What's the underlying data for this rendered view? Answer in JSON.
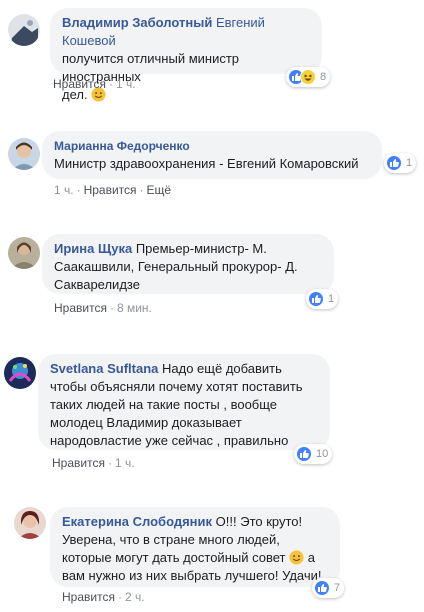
{
  "comments": [
    {
      "author": "Владимир Заболотный",
      "mention": "Евгений Кошевой",
      "text_line1": "получится отличный министр иностранных",
      "text_line2": "дел.",
      "emoji": "smile-emoji",
      "like_label": "Нравится",
      "time": "1 ч.",
      "reaction_count": "8",
      "reaction_icons": [
        "like-icon",
        "haha-icon"
      ],
      "avatar_color": "#3b4a5e"
    },
    {
      "author": "Марианна Федорченко",
      "text": "Министр здравоохранения - Евгений Комаровский",
      "time": "1 ч.",
      "like_label": "Нравится",
      "more_label": "Ещё",
      "reaction_count": "1",
      "reaction_icons": [
        "like-icon"
      ],
      "avatar_color": "#7a9ab5"
    },
    {
      "author": "Ирина Щука",
      "text_part1": "Премьер-министр- М.",
      "text_line2": "Саакашвили, Генеральный прокурор- Д.",
      "text_line3": "Сакварелидзе",
      "like_label": "Нравится",
      "time": "8 мин.",
      "reaction_count": "1",
      "reaction_icons": [
        "like-icon"
      ],
      "avatar_color": "#8a7f6a"
    },
    {
      "author": "Svetlana Sufltana",
      "text_part1": "Надо ещё добавить",
      "text_line2": "чтобы объясняли почему хотят поставить",
      "text_line3": "таких людей на такие посты , вообще",
      "text_line4": "молодец Владимир доказывает",
      "text_line5": "народовластие уже сейчас , правильно",
      "like_label": "Нравится",
      "time": "1 ч.",
      "reaction_count": "10",
      "reaction_icons": [
        "like-icon"
      ],
      "avatar_color": "#2a3f7a"
    },
    {
      "author": "Екатерина Слободяник",
      "text_part1": "О!!! Это круто!",
      "text_line2": "Уверена, что в стране много людей,",
      "text_line3": "которые могут дать достойный совет",
      "text_line3b": "а",
      "emoji": "smile-emoji",
      "text_line4": "вам нужно из них выбрать лучшего! Удачи!",
      "like_label": "Нравится",
      "time": "2 ч.",
      "reaction_count": "7",
      "reaction_icons": [
        "like-icon"
      ],
      "avatar_color": "#a0413f"
    }
  ],
  "colors": {
    "author": "#385898",
    "bubble": "#f2f3f5",
    "like": "#4080ff",
    "meta": "#90949c"
  }
}
